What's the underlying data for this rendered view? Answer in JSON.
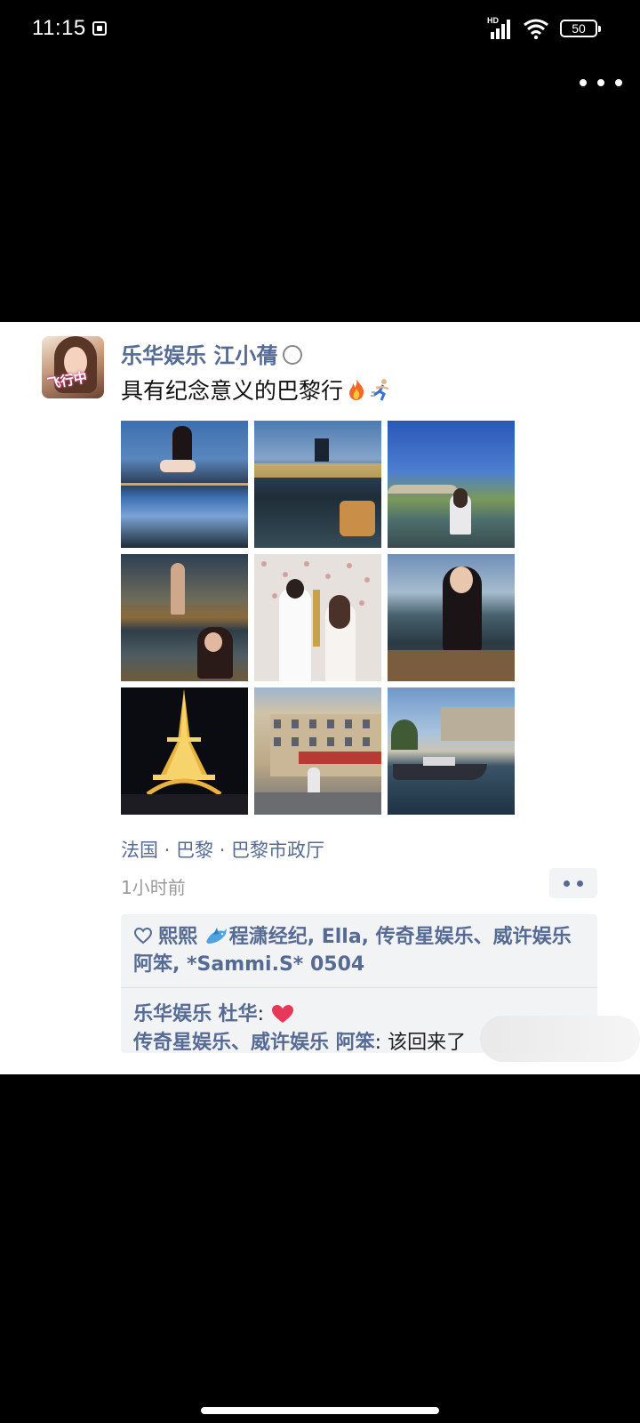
{
  "status_bar": {
    "time": "11:15",
    "network_label": "HD",
    "battery": "50"
  },
  "post": {
    "avatar_tag": "飞行中",
    "username": "乐华娱乐 江小蒨",
    "text": "具有纪念意义的巴黎行",
    "location": "法国 · 巴黎 · 巴黎市政厅",
    "time_ago": "1小时前",
    "likes_text": "熙熙",
    "likes_rest": "程潇经纪, Ella, 传奇星娱乐、威许娱乐 阿笨, *Sammi.S* 0504",
    "comments": [
      {
        "author": "乐华娱乐 杜华",
        "separator": ": ",
        "text": ""
      },
      {
        "author": "传奇星娱乐、威许娱乐 阿笨",
        "separator": ": ",
        "text": "该回来了"
      }
    ]
  },
  "colors": {
    "link": "#566b94",
    "panel": "#f2f3f5",
    "heart": "#e8385a"
  },
  "icons": {
    "post_text_emoji": [
      "fire-icon",
      "runner-icon"
    ],
    "likes_leading": "heart-outline-icon",
    "likes_emoji": "dolphin-icon",
    "comment_emoji": "heart-filled-icon"
  }
}
